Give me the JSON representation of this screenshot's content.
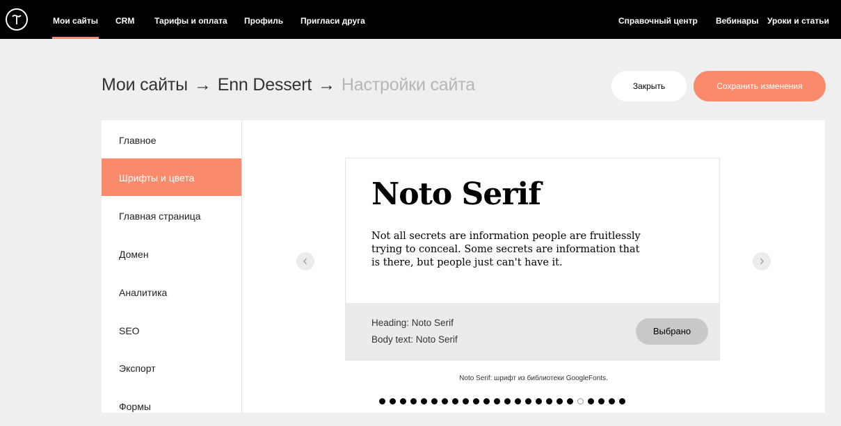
{
  "topnav": {
    "logo": "logo-icon",
    "items": [
      {
        "label": "Мои сайты",
        "active": true
      },
      {
        "label": "CRM"
      },
      {
        "label": "Тарифы и оплата"
      },
      {
        "label": "Профиль"
      },
      {
        "label": "Пригласи друга"
      },
      {
        "label": "Справочный центр"
      },
      {
        "label": "Вебинары"
      },
      {
        "label": "Уроки и статьи"
      }
    ]
  },
  "breadcrumb": {
    "root": "Мои сайты",
    "separator": "→",
    "site": "Enn Dessert",
    "current": "Настройки сайта"
  },
  "actions": {
    "close_label": "Закрыть",
    "save_label": "Сохранить изменения"
  },
  "sidebar": {
    "items": [
      {
        "label": "Главное"
      },
      {
        "label": "Шрифты и цвета",
        "active": true
      },
      {
        "label": "Главная страница"
      },
      {
        "label": "Домен"
      },
      {
        "label": "Аналитика"
      },
      {
        "label": "SEO"
      },
      {
        "label": "Экспорт"
      },
      {
        "label": "Формы"
      }
    ]
  },
  "font_preview": {
    "title": "Noto Serif",
    "sample_text": "Not all secrets are information people are fruitlessly trying to conceal. Some secrets are information that is there, but people just can't have it.",
    "heading_line": "Heading: Noto Serif",
    "body_line": "Body text: Noto Serif",
    "selected_label": "Выбрано",
    "caption": "Noto Serif: шрифт из библиотеки GoogleFonts.",
    "prev_icon": "chevron-left-icon",
    "next_icon": "chevron-right-icon",
    "pagination": {
      "total": 24,
      "current": 20
    }
  },
  "colors": {
    "accent": "#f98a6c",
    "topbar": "#000000",
    "background": "#efefef"
  }
}
